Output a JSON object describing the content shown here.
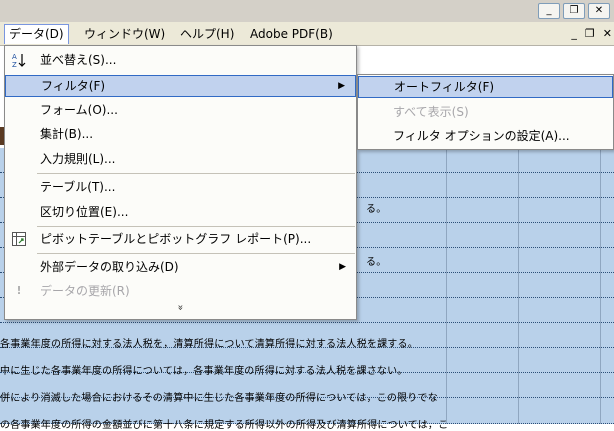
{
  "window_controls": {
    "minimize": "_",
    "restore": "❐",
    "close": "✕"
  },
  "menubar": {
    "items": [
      "データ(D)",
      "ウィンドウ(W)",
      "ヘルプ(H)",
      "Adobe PDF(B)"
    ],
    "mdi": {
      "minimize": "_",
      "restore": "❐",
      "close": "✕"
    }
  },
  "data_menu": {
    "items": [
      {
        "label": "並べ替え(S)...",
        "icon": "sort-icon"
      },
      {
        "label": "フィルタ(F)",
        "has_submenu": true
      },
      {
        "label": "フォーム(O)..."
      },
      {
        "label": "集計(B)..."
      },
      {
        "label": "入力規則(L)..."
      },
      {
        "label": "テーブル(T)..."
      },
      {
        "label": "区切り位置(E)..."
      },
      {
        "label": "ピボットテーブルとピボットグラフ レポート(P)...",
        "icon": "pivot-icon"
      },
      {
        "label": "外部データの取り込み(D)",
        "has_submenu": true
      },
      {
        "label": "データの更新(R)",
        "disabled": true,
        "icon": "refresh-icon"
      }
    ],
    "expand_glyph": "»"
  },
  "filter_submenu": {
    "items": [
      {
        "label": "オートフィルタ(F)"
      },
      {
        "label": "すべて表示(S)",
        "disabled": true
      },
      {
        "label": "フィルタ オプションの設定(A)..."
      }
    ]
  },
  "sheet_rows": {
    "r1": "る。",
    "r2": "る。",
    "r3": "各事業年度の所得に対する法人税を，清算所得について清算所得に対する法人税を課する。",
    "r4": "中に生じた各事業年度の所得については，各事業年度の所得に対する法人税を課さない。",
    "r5": "併により消滅した場合におけるその清算中に生じた各事業年度の所得については，この限りでな",
    "r6": "の各事業年度の所得の金額並びに第十八条に規定する所得以外の所得及び清算所得については，こ"
  }
}
